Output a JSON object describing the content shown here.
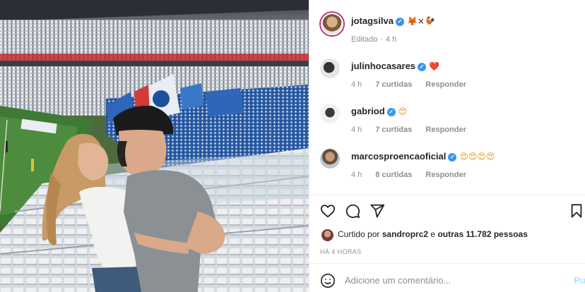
{
  "post": {
    "author": "jotagsilva",
    "author_emoji": "🦊×🐓",
    "edited_label": "Editado",
    "edited_time": "4 h"
  },
  "comments": [
    {
      "username": "julinhocasares",
      "text": "❤️",
      "time": "4 h",
      "likes": "7 curtidas",
      "reply": "Responder"
    },
    {
      "username": "gabriod",
      "text": "😍",
      "time": "4 h",
      "likes": "7 curtidas",
      "reply": "Responder"
    },
    {
      "username": "marcosproencaoficial",
      "text": "😍😍😍😍",
      "time": "4 h",
      "likes": "8 curtidas",
      "reply": "Responder"
    }
  ],
  "likes": {
    "prefix": "Curtido por",
    "user": "sandroprc2",
    "connector": "e",
    "others": "outras 11.782 pessoas"
  },
  "posted_ago": "HÁ 4 HORAS",
  "comment_box": {
    "placeholder": "Adicione um comentário...",
    "publish_label": "Publicar"
  },
  "icons": [
    "heart-icon",
    "comment-icon",
    "share-icon",
    "bookmark-icon",
    "emoji-icon",
    "verified-icon"
  ],
  "colors": {
    "verified": "#3897f0",
    "muted": "#8e8e8e",
    "text": "#262626",
    "heart": "#ed4956",
    "publish_disabled": "#b2dffc"
  }
}
